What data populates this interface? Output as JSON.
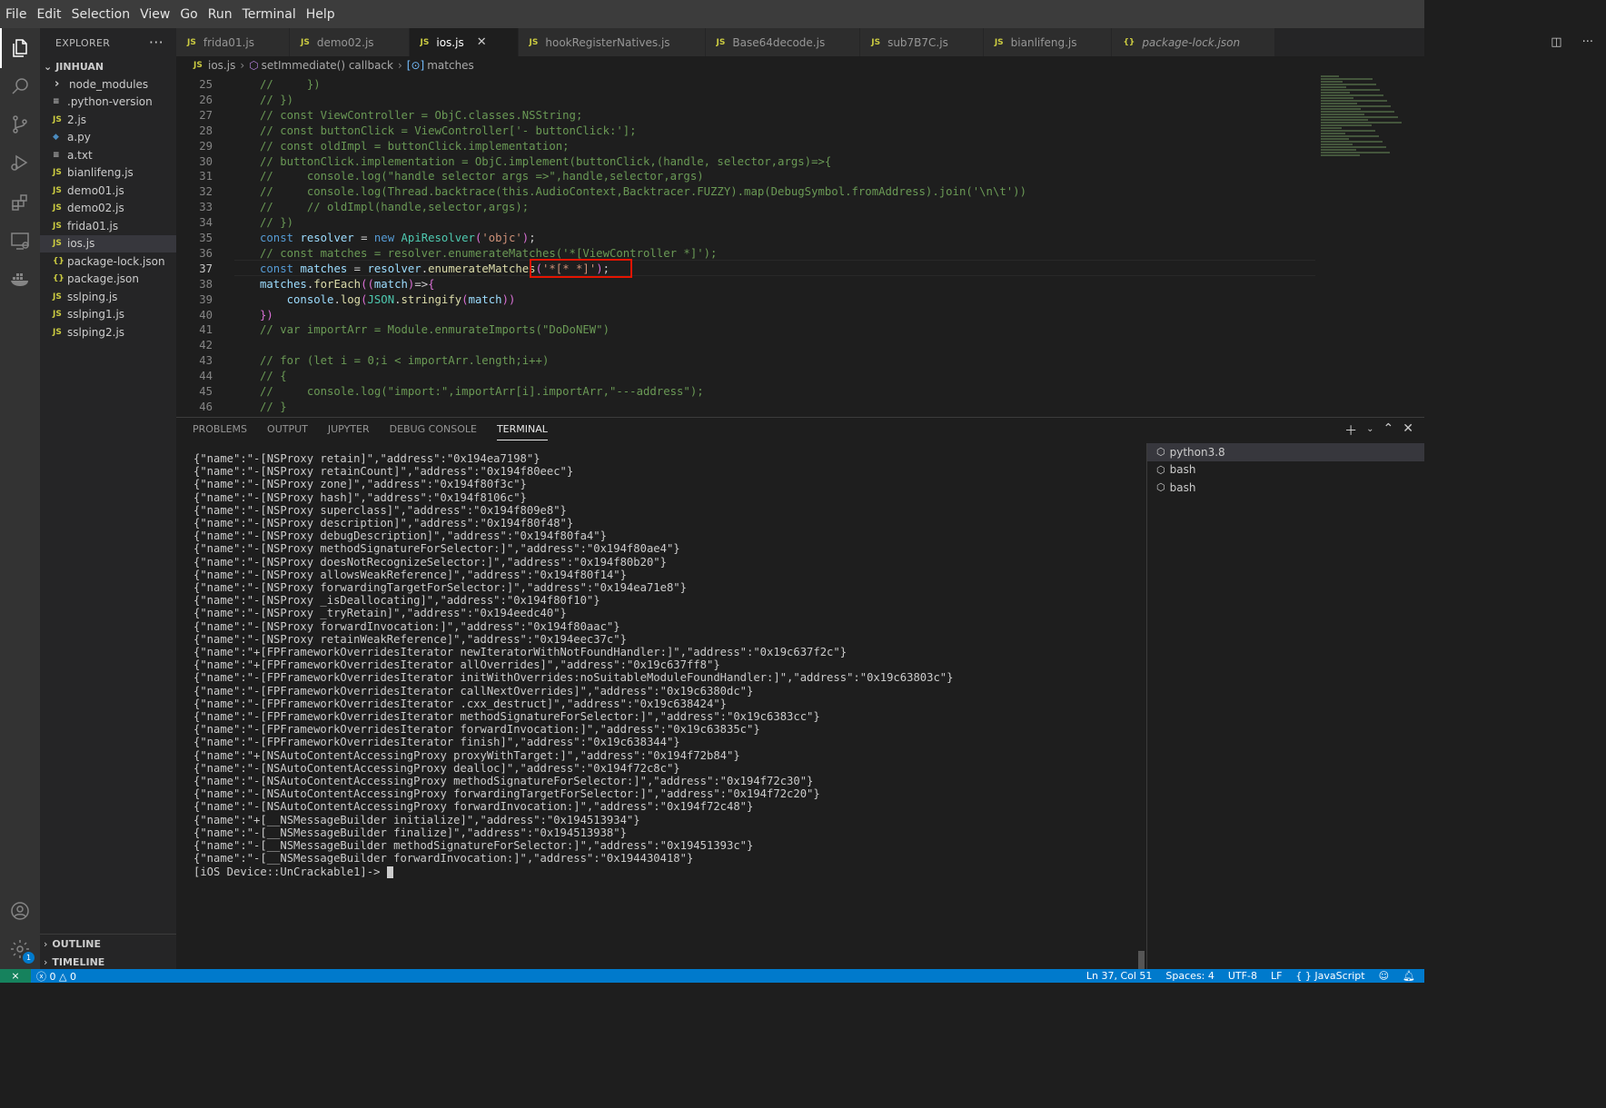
{
  "menu": [
    "File",
    "Edit",
    "Selection",
    "View",
    "Go",
    "Run",
    "Terminal",
    "Help"
  ],
  "explorer": {
    "title": "EXPLORER",
    "more": "···",
    "root": "JINHUAN",
    "items": [
      {
        "label": "node_modules",
        "type": "folder"
      },
      {
        "label": ".python-version",
        "type": "txt"
      },
      {
        "label": "2.js",
        "type": "js"
      },
      {
        "label": "a.py",
        "type": "py"
      },
      {
        "label": "a.txt",
        "type": "txt"
      },
      {
        "label": "bianlifeng.js",
        "type": "js"
      },
      {
        "label": "demo01.js",
        "type": "js"
      },
      {
        "label": "demo02.js",
        "type": "js"
      },
      {
        "label": "frida01.js",
        "type": "js"
      },
      {
        "label": "ios.js",
        "type": "js",
        "selected": true
      },
      {
        "label": "package-lock.json",
        "type": "json"
      },
      {
        "label": "package.json",
        "type": "json"
      },
      {
        "label": "sslping.js",
        "type": "js"
      },
      {
        "label": "sslping1.js",
        "type": "js"
      },
      {
        "label": "sslping2.js",
        "type": "js"
      }
    ],
    "outline": "OUTLINE",
    "timeline": "TIMELINE"
  },
  "tabs": [
    {
      "label": "frida01.js",
      "icon": "JS"
    },
    {
      "label": "demo02.js",
      "icon": "JS"
    },
    {
      "label": "ios.js",
      "icon": "JS",
      "active": true
    },
    {
      "label": "hookRegisterNatives.js",
      "icon": "JS"
    },
    {
      "label": "Base64decode.js",
      "icon": "JS"
    },
    {
      "label": "sub7B7C.js",
      "icon": "JS"
    },
    {
      "label": "bianlifeng.js",
      "icon": "JS"
    },
    {
      "label": "package-lock.json",
      "icon": "{}"
    }
  ],
  "breadcrumb": {
    "file": "ios.js",
    "fn": "setImmediate() callback",
    "var": "matches"
  },
  "code_lines": [
    {
      "n": "25",
      "text": "//     })"
    },
    {
      "n": "26",
      "text": "// })"
    },
    {
      "n": "27",
      "text": "// const ViewController = ObjC.classes.NSString;"
    },
    {
      "n": "28",
      "text": "// const buttonClick = ViewController['- buttonClick:'];"
    },
    {
      "n": "29",
      "text": "// const oldImpl = buttonClick.implementation;"
    },
    {
      "n": "30",
      "text": "// buttonClick.implementation = ObjC.implement(buttonClick,(handle, selector,args)=>{"
    },
    {
      "n": "31",
      "text": "//     console.log(\"handle selector args =>\",handle,selector,args)"
    },
    {
      "n": "32",
      "text": "//     console.log(Thread.backtrace(this.AudioContext,Backtracer.FUZZY).map(DebugSymbol.fromAddress).join('\\n\\t'))"
    },
    {
      "n": "33",
      "text": "//     // oldImpl(handle,selector,args);"
    },
    {
      "n": "34",
      "text": "// })"
    },
    {
      "n": "35",
      "text": "const resolver = new ApiResolver('objc');"
    },
    {
      "n": "36",
      "text": "// const matches = resolver.enumerateMatches('*[ViewController *]');"
    },
    {
      "n": "37",
      "text": "const matches = resolver.enumerateMatches('*[* *]');"
    },
    {
      "n": "38",
      "text": "matches.forEach((match)=>{"
    },
    {
      "n": "39",
      "text": "    console.log(JSON.stringify(match))"
    },
    {
      "n": "40",
      "text": "})"
    },
    {
      "n": "41",
      "text": "// var importArr = Module.enmurateImports(\"DoDoNEW\")"
    },
    {
      "n": "42",
      "text": ""
    },
    {
      "n": "43",
      "text": "// for (let i = 0;i < importArr.length;i++)"
    },
    {
      "n": "44",
      "text": "// {"
    },
    {
      "n": "45",
      "text": "//     console.log(\"import:\",importArr[i].importArr,\"---address\");"
    },
    {
      "n": "46",
      "text": "// }"
    }
  ],
  "panel": {
    "tabs": [
      "PROBLEMS",
      "OUTPUT",
      "JUPYTER",
      "DEBUG CONSOLE",
      "TERMINAL"
    ],
    "active_tab": "TERMINAL",
    "terminal_lines": [
      "{\"name\":\"-[NSProxy retain]\",\"address\":\"0x194ea7198\"}",
      "{\"name\":\"-[NSProxy retainCount]\",\"address\":\"0x194f80eec\"}",
      "{\"name\":\"-[NSProxy zone]\",\"address\":\"0x194f80f3c\"}",
      "{\"name\":\"-[NSProxy hash]\",\"address\":\"0x194f8106c\"}",
      "{\"name\":\"-[NSProxy superclass]\",\"address\":\"0x194f809e8\"}",
      "{\"name\":\"-[NSProxy description]\",\"address\":\"0x194f80f48\"}",
      "{\"name\":\"-[NSProxy debugDescription]\",\"address\":\"0x194f80fa4\"}",
      "{\"name\":\"-[NSProxy methodSignatureForSelector:]\",\"address\":\"0x194f80ae4\"}",
      "{\"name\":\"-[NSProxy doesNotRecognizeSelector:]\",\"address\":\"0x194f80b20\"}",
      "{\"name\":\"-[NSProxy allowsWeakReference]\",\"address\":\"0x194f80f14\"}",
      "{\"name\":\"-[NSProxy forwardingTargetForSelector:]\",\"address\":\"0x194ea71e8\"}",
      "{\"name\":\"-[NSProxy _isDeallocating]\",\"address\":\"0x194f80f10\"}",
      "{\"name\":\"-[NSProxy _tryRetain]\",\"address\":\"0x194eedc40\"}",
      "{\"name\":\"-[NSProxy forwardInvocation:]\",\"address\":\"0x194f80aac\"}",
      "{\"name\":\"-[NSProxy retainWeakReference]\",\"address\":\"0x194eec37c\"}",
      "{\"name\":\"+[FPFrameworkOverridesIterator newIteratorWithNotFoundHandler:]\",\"address\":\"0x19c637f2c\"}",
      "{\"name\":\"+[FPFrameworkOverridesIterator allOverrides]\",\"address\":\"0x19c637ff8\"}",
      "{\"name\":\"-[FPFrameworkOverridesIterator initWithOverrides:noSuitableModuleFoundHandler:]\",\"address\":\"0x19c63803c\"}",
      "{\"name\":\"-[FPFrameworkOverridesIterator callNextOverrides]\",\"address\":\"0x19c6380dc\"}",
      "{\"name\":\"-[FPFrameworkOverridesIterator .cxx_destruct]\",\"address\":\"0x19c638424\"}",
      "{\"name\":\"-[FPFrameworkOverridesIterator methodSignatureForSelector:]\",\"address\":\"0x19c6383cc\"}",
      "{\"name\":\"-[FPFrameworkOverridesIterator forwardInvocation:]\",\"address\":\"0x19c63835c\"}",
      "{\"name\":\"-[FPFrameworkOverridesIterator finish]\",\"address\":\"0x19c638344\"}",
      "{\"name\":\"+[NSAutoContentAccessingProxy proxyWithTarget:]\",\"address\":\"0x194f72b84\"}",
      "{\"name\":\"-[NSAutoContentAccessingProxy dealloc]\",\"address\":\"0x194f72c8c\"}",
      "{\"name\":\"-[NSAutoContentAccessingProxy methodSignatureForSelector:]\",\"address\":\"0x194f72c30\"}",
      "{\"name\":\"-[NSAutoContentAccessingProxy forwardingTargetForSelector:]\",\"address\":\"0x194f72c20\"}",
      "{\"name\":\"-[NSAutoContentAccessingProxy forwardInvocation:]\",\"address\":\"0x194f72c48\"}",
      "{\"name\":\"+[__NSMessageBuilder initialize]\",\"address\":\"0x194513934\"}",
      "{\"name\":\"-[__NSMessageBuilder finalize]\",\"address\":\"0x194513938\"}",
      "{\"name\":\"-[__NSMessageBuilder methodSignatureForSelector:]\",\"address\":\"0x19451393c\"}",
      "{\"name\":\"-[__NSMessageBuilder forwardInvocation:]\",\"address\":\"0x194430418\"}"
    ],
    "prompt": "[iOS Device::UnCrackable1]-> ",
    "terminals": [
      "python3.8",
      "bash",
      "bash"
    ]
  },
  "status": {
    "errors": "0",
    "warnings": "0",
    "position": "Ln 37, Col 51",
    "spaces": "Spaces: 4",
    "encoding": "UTF-8",
    "eol": "LF",
    "language": "JavaScript",
    "language_icon": "{ }",
    "settings_badge": "1"
  },
  "colors": {
    "statusbar": "#007acc",
    "accent_red": "#e51400"
  }
}
